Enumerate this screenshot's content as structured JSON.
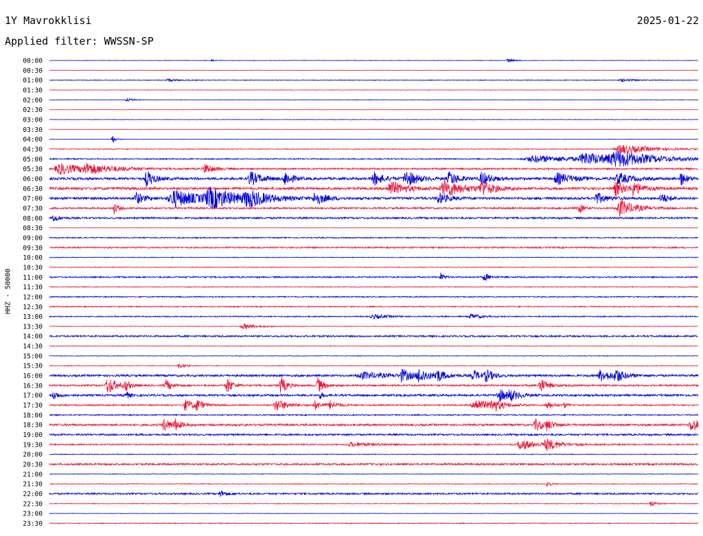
{
  "header": {
    "station": "1Y Mavrokklisi",
    "date": "2025-01-22",
    "filter": "Applied filter: WWSSN-SP"
  },
  "channel_label": "HHZ - 50000",
  "colors": {
    "even_rows": "#0000dd",
    "odd_rows": "#ee1133"
  },
  "chart_data": {
    "type": "line",
    "title": "",
    "ylabel": "HHZ - 50000",
    "row_labels": [
      "00:00",
      "00:30",
      "01:00",
      "01:30",
      "02:00",
      "02:30",
      "03:00",
      "03:30",
      "04:00",
      "04:30",
      "05:00",
      "05:30",
      "06:00",
      "06:30",
      "07:00",
      "07:30",
      "08:00",
      "08:30",
      "09:00",
      "09:30",
      "10:00",
      "10:30",
      "11:00",
      "11:30",
      "12:00",
      "12:30",
      "13:00",
      "13:30",
      "14:00",
      "14:30",
      "15:00",
      "15:30",
      "16:00",
      "16:30",
      "17:00",
      "17:30",
      "18:00",
      "18:30",
      "19:00",
      "19:30",
      "20:00",
      "20:30",
      "21:00",
      "21:30",
      "22:00",
      "22:30",
      "23:00",
      "23:30"
    ],
    "x_range_minutes": [
      0,
      30
    ],
    "noise_level": [
      0.3,
      0.3,
      0.5,
      0.3,
      0.3,
      0.2,
      0.3,
      0.2,
      0.3,
      0.6,
      0.8,
      1.2,
      1.8,
      1.8,
      1.8,
      1.3,
      1.3,
      0.2,
      0.8,
      1.0,
      0.5,
      0.5,
      1.0,
      0.5,
      0.8,
      0.8,
      0.8,
      0.4,
      1.2,
      0.4,
      0.4,
      0.5,
      1.5,
      1.3,
      1.5,
      1.0,
      0.8,
      1.5,
      1.3,
      1.0,
      0.5,
      1.4,
      0.4,
      0.5,
      1.2,
      0.5,
      0.3,
      0.6
    ],
    "events": [
      {
        "row": 0,
        "t": 21.2,
        "amp": 3,
        "dur": 0.3
      },
      {
        "row": 0,
        "t": 7.5,
        "amp": 2,
        "dur": 0.1
      },
      {
        "row": 2,
        "t": 5.5,
        "amp": 2,
        "dur": 0.5
      },
      {
        "row": 2,
        "t": 26.5,
        "amp": 2,
        "dur": 0.6
      },
      {
        "row": 4,
        "t": 3.6,
        "amp": 2,
        "dur": 0.4
      },
      {
        "row": 8,
        "t": 2.9,
        "amp": 8,
        "dur": 0.15
      },
      {
        "row": 10,
        "t": 22.5,
        "amp": 5,
        "dur": 2.5
      },
      {
        "row": 10,
        "t": 24.8,
        "amp": 8,
        "dur": 1.5
      },
      {
        "row": 10,
        "t": 26.3,
        "amp": 9,
        "dur": 2.2
      },
      {
        "row": 9,
        "t": 26.5,
        "amp": 7,
        "dur": 1.5
      },
      {
        "row": 11,
        "t": 0.5,
        "amp": 8,
        "dur": 1.2
      },
      {
        "row": 11,
        "t": 1.8,
        "amp": 6,
        "dur": 1.5
      },
      {
        "row": 11,
        "t": 7.2,
        "amp": 8,
        "dur": 0.4
      },
      {
        "row": 12,
        "t": 4.5,
        "amp": 12,
        "dur": 0.4
      },
      {
        "row": 12,
        "t": 9.3,
        "amp": 10,
        "dur": 0.6
      },
      {
        "row": 12,
        "t": 10.9,
        "amp": 10,
        "dur": 0.4
      },
      {
        "row": 12,
        "t": 15.0,
        "amp": 10,
        "dur": 0.5
      },
      {
        "row": 12,
        "t": 16.5,
        "amp": 12,
        "dur": 0.6
      },
      {
        "row": 12,
        "t": 18.5,
        "amp": 10,
        "dur": 0.5
      },
      {
        "row": 12,
        "t": 20.0,
        "amp": 10,
        "dur": 0.5
      },
      {
        "row": 12,
        "t": 23.5,
        "amp": 8,
        "dur": 0.8
      },
      {
        "row": 12,
        "t": 26.3,
        "amp": 8,
        "dur": 0.7
      },
      {
        "row": 12,
        "t": 29.2,
        "amp": 10,
        "dur": 0.3
      },
      {
        "row": 13,
        "t": 15.8,
        "amp": 10,
        "dur": 0.8
      },
      {
        "row": 13,
        "t": 18.3,
        "amp": 12,
        "dur": 1.0
      },
      {
        "row": 13,
        "t": 20.0,
        "amp": 10,
        "dur": 0.6
      },
      {
        "row": 13,
        "t": 26.2,
        "amp": 10,
        "dur": 0.6
      },
      {
        "row": 13,
        "t": 27.0,
        "amp": 8,
        "dur": 0.5
      },
      {
        "row": 14,
        "t": 4.0,
        "amp": 9,
        "dur": 0.4
      },
      {
        "row": 14,
        "t": 5.8,
        "amp": 12,
        "dur": 1.4
      },
      {
        "row": 14,
        "t": 7.5,
        "amp": 13,
        "dur": 1.5
      },
      {
        "row": 14,
        "t": 9.2,
        "amp": 10,
        "dur": 1.0
      },
      {
        "row": 14,
        "t": 12.3,
        "amp": 10,
        "dur": 0.5
      },
      {
        "row": 14,
        "t": 18.0,
        "amp": 8,
        "dur": 0.5
      },
      {
        "row": 14,
        "t": 25.3,
        "amp": 8,
        "dur": 0.5
      },
      {
        "row": 14,
        "t": 28.3,
        "amp": 7,
        "dur": 0.4
      },
      {
        "row": 15,
        "t": 3.0,
        "amp": 8,
        "dur": 0.2
      },
      {
        "row": 15,
        "t": 24.5,
        "amp": 8,
        "dur": 0.2
      },
      {
        "row": 15,
        "t": 26.4,
        "amp": 12,
        "dur": 0.8
      },
      {
        "row": 16,
        "t": 0.2,
        "amp": 5,
        "dur": 0.3
      },
      {
        "row": 22,
        "t": 18.1,
        "amp": 6,
        "dur": 0.2
      },
      {
        "row": 22,
        "t": 20.1,
        "amp": 6,
        "dur": 0.3
      },
      {
        "row": 26,
        "t": 15.0,
        "amp": 3,
        "dur": 0.8
      },
      {
        "row": 26,
        "t": 19.5,
        "amp": 4,
        "dur": 0.5
      },
      {
        "row": 27,
        "t": 9.0,
        "amp": 4,
        "dur": 0.8
      },
      {
        "row": 31,
        "t": 6.0,
        "amp": 4,
        "dur": 0.3
      },
      {
        "row": 32,
        "t": 14.5,
        "amp": 5,
        "dur": 1.2
      },
      {
        "row": 32,
        "t": 16.3,
        "amp": 9,
        "dur": 0.5
      },
      {
        "row": 32,
        "t": 17.1,
        "amp": 10,
        "dur": 0.5
      },
      {
        "row": 32,
        "t": 17.9,
        "amp": 8,
        "dur": 0.5
      },
      {
        "row": 32,
        "t": 19.6,
        "amp": 8,
        "dur": 0.4
      },
      {
        "row": 32,
        "t": 20.2,
        "amp": 8,
        "dur": 0.4
      },
      {
        "row": 32,
        "t": 25.5,
        "amp": 8,
        "dur": 0.7
      },
      {
        "row": 32,
        "t": 26.2,
        "amp": 9,
        "dur": 0.4
      },
      {
        "row": 33,
        "t": 2.7,
        "amp": 12,
        "dur": 0.5
      },
      {
        "row": 33,
        "t": 3.5,
        "amp": 8,
        "dur": 0.2
      },
      {
        "row": 33,
        "t": 5.4,
        "amp": 8,
        "dur": 0.3
      },
      {
        "row": 33,
        "t": 8.2,
        "amp": 12,
        "dur": 0.3
      },
      {
        "row": 33,
        "t": 10.7,
        "amp": 13,
        "dur": 0.3
      },
      {
        "row": 33,
        "t": 12.4,
        "amp": 12,
        "dur": 0.3
      },
      {
        "row": 33,
        "t": 22.7,
        "amp": 10,
        "dur": 0.4
      },
      {
        "row": 34,
        "t": 0.2,
        "amp": 6,
        "dur": 0.3
      },
      {
        "row": 34,
        "t": 3.5,
        "amp": 7,
        "dur": 0.2
      },
      {
        "row": 34,
        "t": 20.8,
        "amp": 9,
        "dur": 0.5
      },
      {
        "row": 34,
        "t": 21.3,
        "amp": 6,
        "dur": 0.5
      },
      {
        "row": 34,
        "t": 12.5,
        "amp": 5,
        "dur": 0.2
      },
      {
        "row": 35,
        "t": 6.3,
        "amp": 8,
        "dur": 0.5
      },
      {
        "row": 35,
        "t": 6.8,
        "amp": 8,
        "dur": 0.3
      },
      {
        "row": 35,
        "t": 10.5,
        "amp": 9,
        "dur": 0.6
      },
      {
        "row": 35,
        "t": 12.3,
        "amp": 6,
        "dur": 0.4
      },
      {
        "row": 35,
        "t": 13.0,
        "amp": 6,
        "dur": 0.4
      },
      {
        "row": 35,
        "t": 19.7,
        "amp": 9,
        "dur": 0.8
      },
      {
        "row": 35,
        "t": 20.5,
        "amp": 8,
        "dur": 0.5
      },
      {
        "row": 35,
        "t": 23.0,
        "amp": 7,
        "dur": 0.3
      },
      {
        "row": 35,
        "t": 23.8,
        "amp": 4,
        "dur": 0.2
      },
      {
        "row": 37,
        "t": 5.3,
        "amp": 9,
        "dur": 0.4
      },
      {
        "row": 37,
        "t": 5.8,
        "amp": 7,
        "dur": 0.3
      },
      {
        "row": 37,
        "t": 22.5,
        "amp": 8,
        "dur": 0.5
      },
      {
        "row": 37,
        "t": 23.0,
        "amp": 6,
        "dur": 0.3
      },
      {
        "row": 37,
        "t": 29.7,
        "amp": 9,
        "dur": 0.6
      },
      {
        "row": 39,
        "t": 14.0,
        "amp": 3,
        "dur": 1.2
      },
      {
        "row": 39,
        "t": 21.8,
        "amp": 8,
        "dur": 0.7
      },
      {
        "row": 39,
        "t": 23.0,
        "amp": 8,
        "dur": 0.7
      },
      {
        "row": 43,
        "t": 23.0,
        "amp": 5,
        "dur": 0.2
      },
      {
        "row": 44,
        "t": 7.9,
        "amp": 5,
        "dur": 0.3
      },
      {
        "row": 45,
        "t": 27.8,
        "amp": 4,
        "dur": 0.3
      }
    ]
  }
}
